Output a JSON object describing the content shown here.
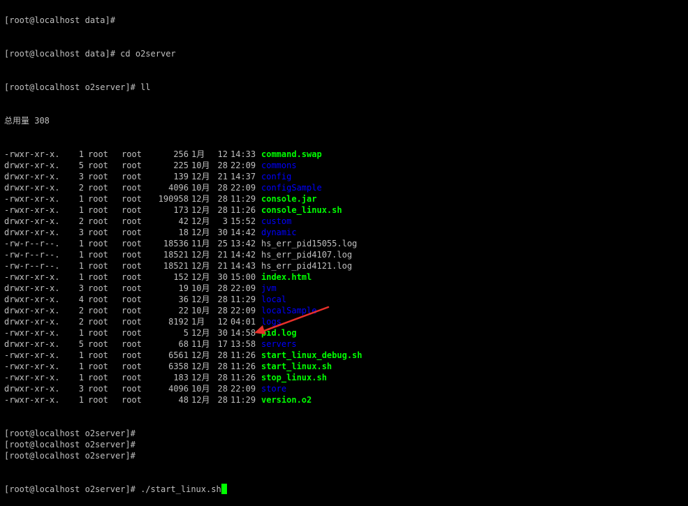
{
  "terminal": {
    "top_partial": "[root@localhost data]#",
    "prompt_cd": "[root@localhost data]# cd o2server",
    "prompt_ll": "[root@localhost o2server]# ll",
    "total": "总用量 308",
    "entries": [
      {
        "perm": "-rwxr-xr-x.",
        "links": "1",
        "user": "root",
        "group": "root",
        "size": "256",
        "month": "1月",
        "day": "12",
        "time": "14:33",
        "name": "command.swap",
        "type": "exec"
      },
      {
        "perm": "drwxr-xr-x.",
        "links": "5",
        "user": "root",
        "group": "root",
        "size": "225",
        "month": "10月",
        "day": "28",
        "time": "22:09",
        "name": "commons",
        "type": "dir"
      },
      {
        "perm": "drwxr-xr-x.",
        "links": "3",
        "user": "root",
        "group": "root",
        "size": "139",
        "month": "12月",
        "day": "21",
        "time": "14:37",
        "name": "config",
        "type": "dir"
      },
      {
        "perm": "drwxr-xr-x.",
        "links": "2",
        "user": "root",
        "group": "root",
        "size": "4096",
        "month": "10月",
        "day": "28",
        "time": "22:09",
        "name": "configSample",
        "type": "dir"
      },
      {
        "perm": "-rwxr-xr-x.",
        "links": "1",
        "user": "root",
        "group": "root",
        "size": "190958",
        "month": "12月",
        "day": "28",
        "time": "11:29",
        "name": "console.jar",
        "type": "exec"
      },
      {
        "perm": "-rwxr-xr-x.",
        "links": "1",
        "user": "root",
        "group": "root",
        "size": "173",
        "month": "12月",
        "day": "28",
        "time": "11:26",
        "name": "console_linux.sh",
        "type": "exec"
      },
      {
        "perm": "drwxr-xr-x.",
        "links": "2",
        "user": "root",
        "group": "root",
        "size": "42",
        "month": "12月",
        "day": "3",
        "time": "15:52",
        "name": "custom",
        "type": "dir"
      },
      {
        "perm": "drwxr-xr-x.",
        "links": "3",
        "user": "root",
        "group": "root",
        "size": "18",
        "month": "12月",
        "day": "30",
        "time": "14:42",
        "name": "dynamic",
        "type": "dir"
      },
      {
        "perm": "-rw-r--r--.",
        "links": "1",
        "user": "root",
        "group": "root",
        "size": "18536",
        "month": "11月",
        "day": "25",
        "time": "13:42",
        "name": "hs_err_pid15055.log",
        "type": "reg"
      },
      {
        "perm": "-rw-r--r--.",
        "links": "1",
        "user": "root",
        "group": "root",
        "size": "18521",
        "month": "12月",
        "day": "21",
        "time": "14:42",
        "name": "hs_err_pid4107.log",
        "type": "reg"
      },
      {
        "perm": "-rw-r--r--.",
        "links": "1",
        "user": "root",
        "group": "root",
        "size": "18521",
        "month": "12月",
        "day": "21",
        "time": "14:43",
        "name": "hs_err_pid4121.log",
        "type": "reg"
      },
      {
        "perm": "-rwxr-xr-x.",
        "links": "1",
        "user": "root",
        "group": "root",
        "size": "152",
        "month": "12月",
        "day": "30",
        "time": "15:00",
        "name": "index.html",
        "type": "exec"
      },
      {
        "perm": "drwxr-xr-x.",
        "links": "3",
        "user": "root",
        "group": "root",
        "size": "19",
        "month": "10月",
        "day": "28",
        "time": "22:09",
        "name": "jvm",
        "type": "dir"
      },
      {
        "perm": "drwxr-xr-x.",
        "links": "4",
        "user": "root",
        "group": "root",
        "size": "36",
        "month": "12月",
        "day": "28",
        "time": "11:29",
        "name": "local",
        "type": "dir"
      },
      {
        "perm": "drwxr-xr-x.",
        "links": "2",
        "user": "root",
        "group": "root",
        "size": "22",
        "month": "10月",
        "day": "28",
        "time": "22:09",
        "name": "localSample",
        "type": "dir"
      },
      {
        "perm": "drwxr-xr-x.",
        "links": "2",
        "user": "root",
        "group": "root",
        "size": "8192",
        "month": "1月",
        "day": "12",
        "time": "04:01",
        "name": "logs",
        "type": "dir"
      },
      {
        "perm": "-rwxr-xr-x.",
        "links": "1",
        "user": "root",
        "group": "root",
        "size": "5",
        "month": "12月",
        "day": "30",
        "time": "14:58",
        "name": "pid.log",
        "type": "exec"
      },
      {
        "perm": "drwxr-xr-x.",
        "links": "5",
        "user": "root",
        "group": "root",
        "size": "68",
        "month": "11月",
        "day": "17",
        "time": "13:58",
        "name": "servers",
        "type": "dir"
      },
      {
        "perm": "-rwxr-xr-x.",
        "links": "1",
        "user": "root",
        "group": "root",
        "size": "6561",
        "month": "12月",
        "day": "28",
        "time": "11:26",
        "name": "start_linux_debug.sh",
        "type": "exec"
      },
      {
        "perm": "-rwxr-xr-x.",
        "links": "1",
        "user": "root",
        "group": "root",
        "size": "6358",
        "month": "12月",
        "day": "28",
        "time": "11:26",
        "name": "start_linux.sh",
        "type": "exec"
      },
      {
        "perm": "-rwxr-xr-x.",
        "links": "1",
        "user": "root",
        "group": "root",
        "size": "183",
        "month": "12月",
        "day": "28",
        "time": "11:26",
        "name": "stop_linux.sh",
        "type": "exec"
      },
      {
        "perm": "drwxr-xr-x.",
        "links": "3",
        "user": "root",
        "group": "root",
        "size": "4096",
        "month": "10月",
        "day": "28",
        "time": "22:09",
        "name": "store",
        "type": "dir"
      },
      {
        "perm": "-rwxr-xr-x.",
        "links": "1",
        "user": "root",
        "group": "root",
        "size": "48",
        "month": "12月",
        "day": "28",
        "time": "11:29",
        "name": "version.o2",
        "type": "exec"
      }
    ],
    "empty_prompts": [
      "[root@localhost o2server]#",
      "[root@localhost o2server]#",
      "[root@localhost o2server]#"
    ],
    "final_prompt": "[root@localhost o2server]# ",
    "final_command": "./start_linux.sh"
  },
  "colors": {
    "background": "#000000",
    "text": "#c0c0c0",
    "executable": "#00ff00",
    "directory": "#0000ff",
    "cursor": "#00ff00",
    "annotation_arrow": "#e8302a"
  }
}
